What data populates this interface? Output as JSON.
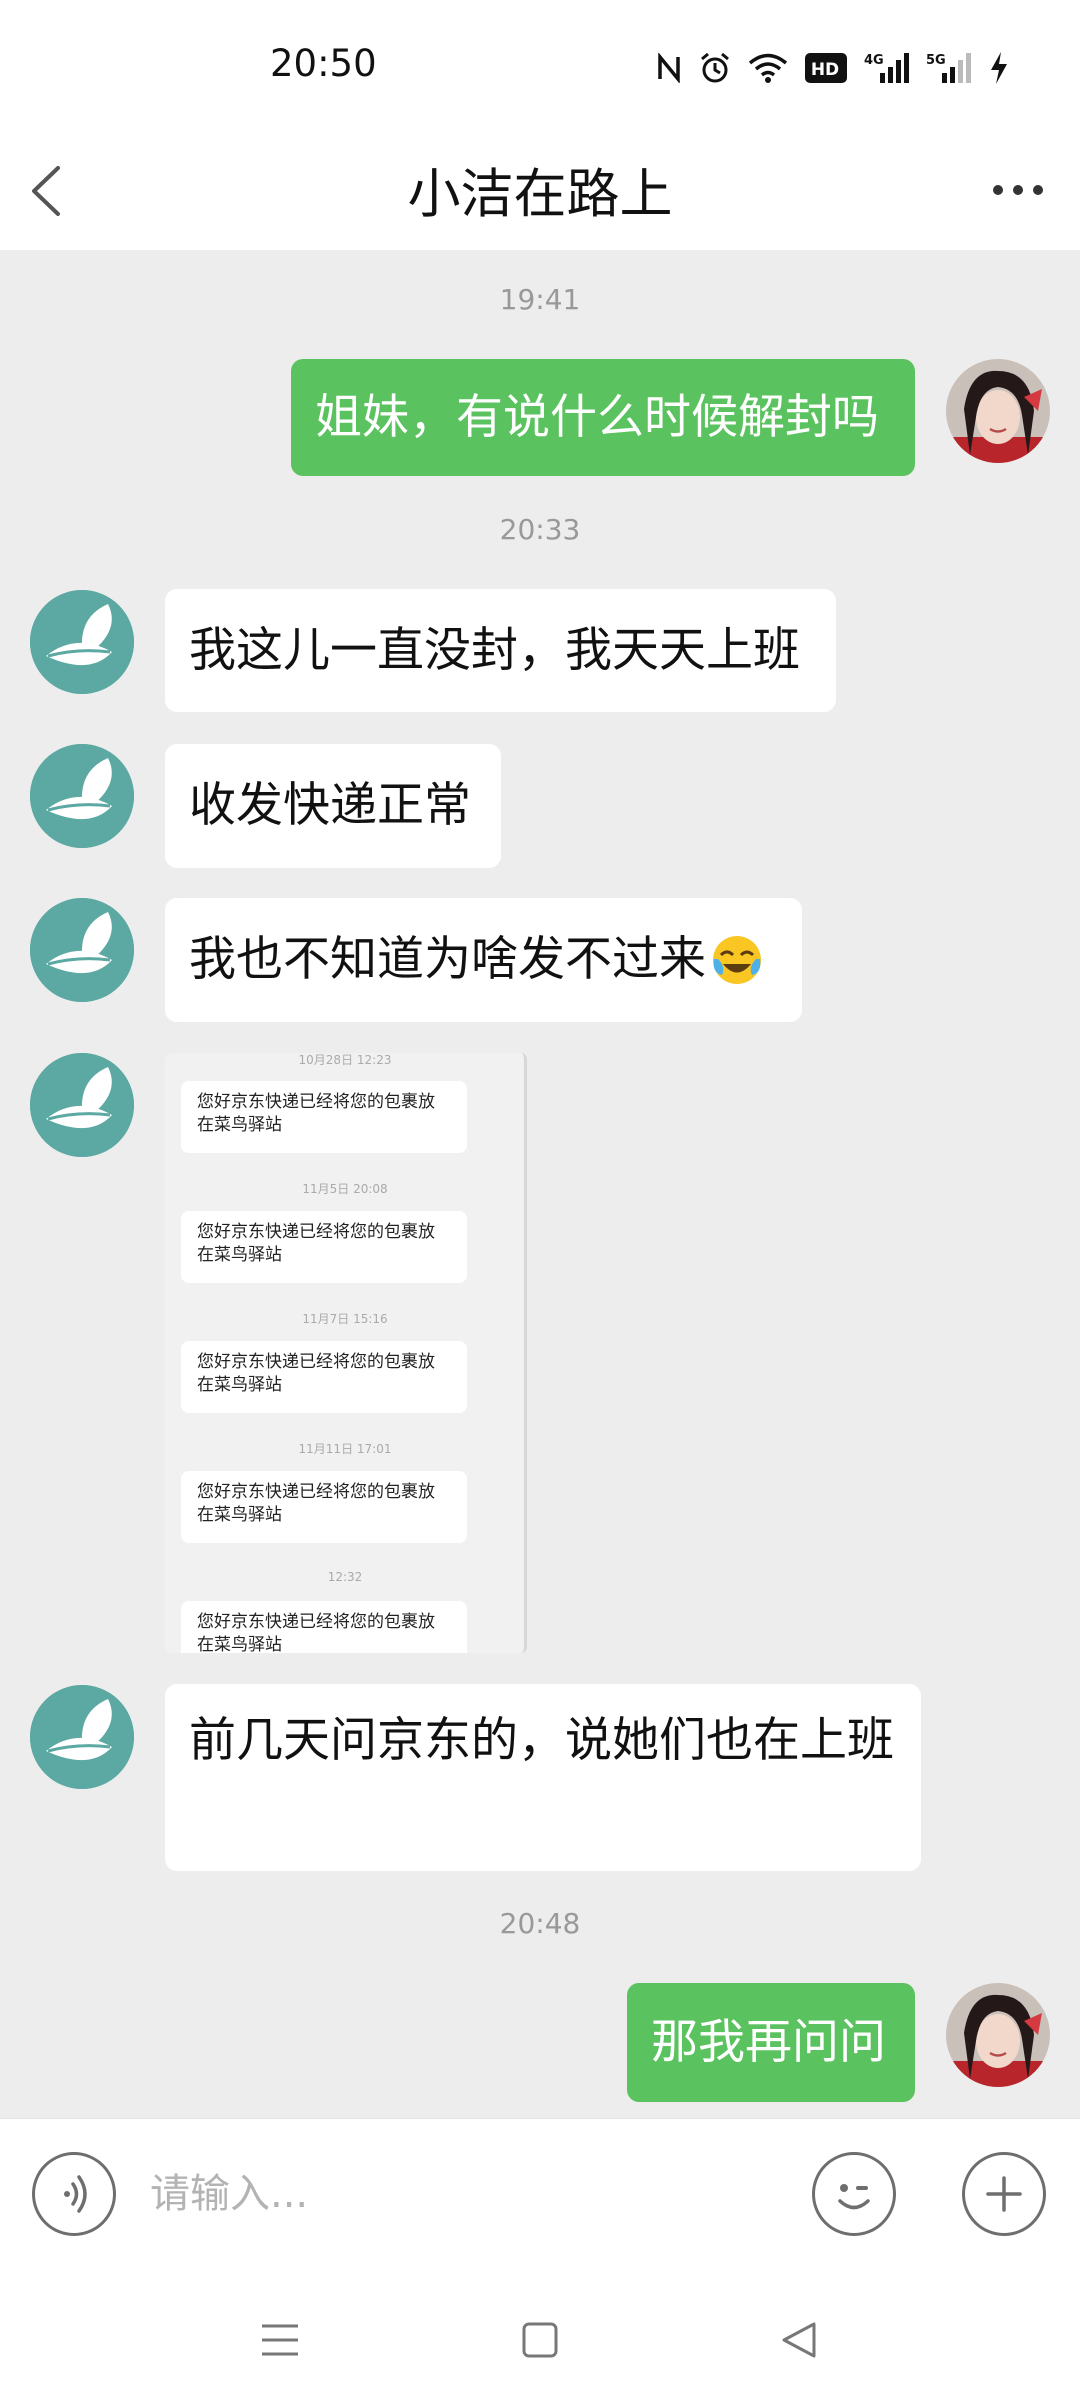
{
  "status_bar": {
    "time": "20:50",
    "icons": [
      "nfc-icon",
      "alarm-icon",
      "wifi-icon",
      "hd-icon",
      "signal-4g-icon",
      "signal-5g-icon",
      "charging-icon"
    ],
    "hd_label": "HD",
    "net_4g": "4G",
    "net_5g": "5G"
  },
  "nav": {
    "title": "小洁在路上"
  },
  "messages": [
    {
      "type": "timestamp",
      "text": "19:41"
    },
    {
      "type": "text",
      "sender": "self",
      "text": "姐妹，有说什么时候解封吗"
    },
    {
      "type": "timestamp",
      "text": "20:33"
    },
    {
      "type": "text",
      "sender": "other",
      "text": "我这儿一直没封，我天天上班"
    },
    {
      "type": "text",
      "sender": "other",
      "text": "收发快递正常"
    },
    {
      "type": "text",
      "sender": "other",
      "text": "我也不知道为啥发不过来",
      "emoji": "crying-laughing-emoji"
    },
    {
      "type": "image",
      "sender": "other",
      "screenshot": {
        "entries": [
          {
            "time": "10月28日 12:23",
            "text": "您好京东快递已经将您的包裹放在菜鸟驿站"
          },
          {
            "time": "11月5日 20:08",
            "text": "您好京东快递已经将您的包裹放在菜鸟驿站"
          },
          {
            "time": "11月7日 15:16",
            "text": "您好京东快递已经将您的包裹放在菜鸟驿站"
          },
          {
            "time": "11月11日 17:01",
            "text": "您好京东快递已经将您的包裹放在菜鸟驿站"
          },
          {
            "time": "12:32",
            "text": "您好京东快递已经将您的包裹放在菜鸟驿站"
          }
        ]
      }
    },
    {
      "type": "text",
      "sender": "other",
      "text": "前几天问京东的，说她们也在上班"
    },
    {
      "type": "timestamp",
      "text": "20:48"
    },
    {
      "type": "text",
      "sender": "self",
      "text": "那我再问问"
    }
  ],
  "input": {
    "placeholder": "请输入..."
  },
  "colors": {
    "self_bubble": "#5ac25e",
    "other_bubble": "#ffffff",
    "chat_background": "#ededed",
    "other_avatar": "#5ba9a2"
  }
}
